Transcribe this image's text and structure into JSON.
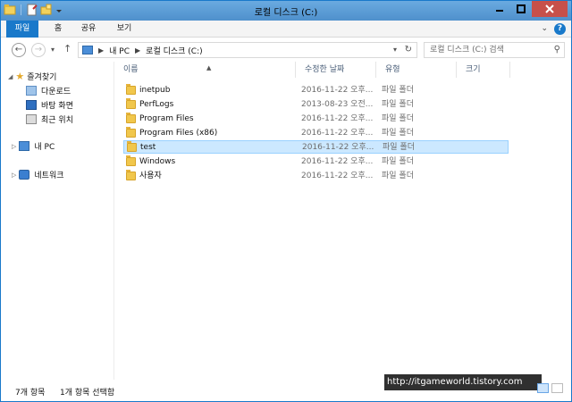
{
  "window": {
    "title": "로컬 디스크 (C:)"
  },
  "ribbon": {
    "tabs": [
      "파일",
      "홈",
      "공유",
      "보기"
    ]
  },
  "nav": {
    "back_icon": "back-arrow-icon",
    "address": [
      "내 PC",
      "로컬 디스크 (C:)"
    ],
    "search_placeholder": "로컬 디스크 (C:) 검색"
  },
  "navpane": {
    "favorites_label": "즐겨찾기",
    "favorites": [
      "다운로드",
      "바탕 화면",
      "최근 위치"
    ],
    "this_pc": "내 PC",
    "network": "네트워크"
  },
  "columns": [
    "이름",
    "수정한 날짜",
    "유형",
    "크기"
  ],
  "files": [
    {
      "name": "inetpub",
      "date": "2016-11-22 오후...",
      "type": "파일 폴더",
      "selected": false
    },
    {
      "name": "PerfLogs",
      "date": "2013-08-23 오전...",
      "type": "파일 폴더",
      "selected": false
    },
    {
      "name": "Program Files",
      "date": "2016-11-22 오후...",
      "type": "파일 폴더",
      "selected": false
    },
    {
      "name": "Program Files (x86)",
      "date": "2016-11-22 오후...",
      "type": "파일 폴더",
      "selected": false
    },
    {
      "name": "test",
      "date": "2016-11-22 오후...",
      "type": "파일 폴더",
      "selected": true
    },
    {
      "name": "Windows",
      "date": "2016-11-22 오후...",
      "type": "파일 폴더",
      "selected": false
    },
    {
      "name": "사용자",
      "date": "2016-11-22 오후...",
      "type": "파일 폴더",
      "selected": false
    }
  ],
  "status": {
    "item_count": "7개 항목",
    "selected": "1개 항목 선택함"
  },
  "watermark": "http://itgameworld.tistory.com",
  "colors": {
    "accent": "#1979ca",
    "selection": "#cce8ff",
    "titlebar": "#5a9bd5"
  }
}
